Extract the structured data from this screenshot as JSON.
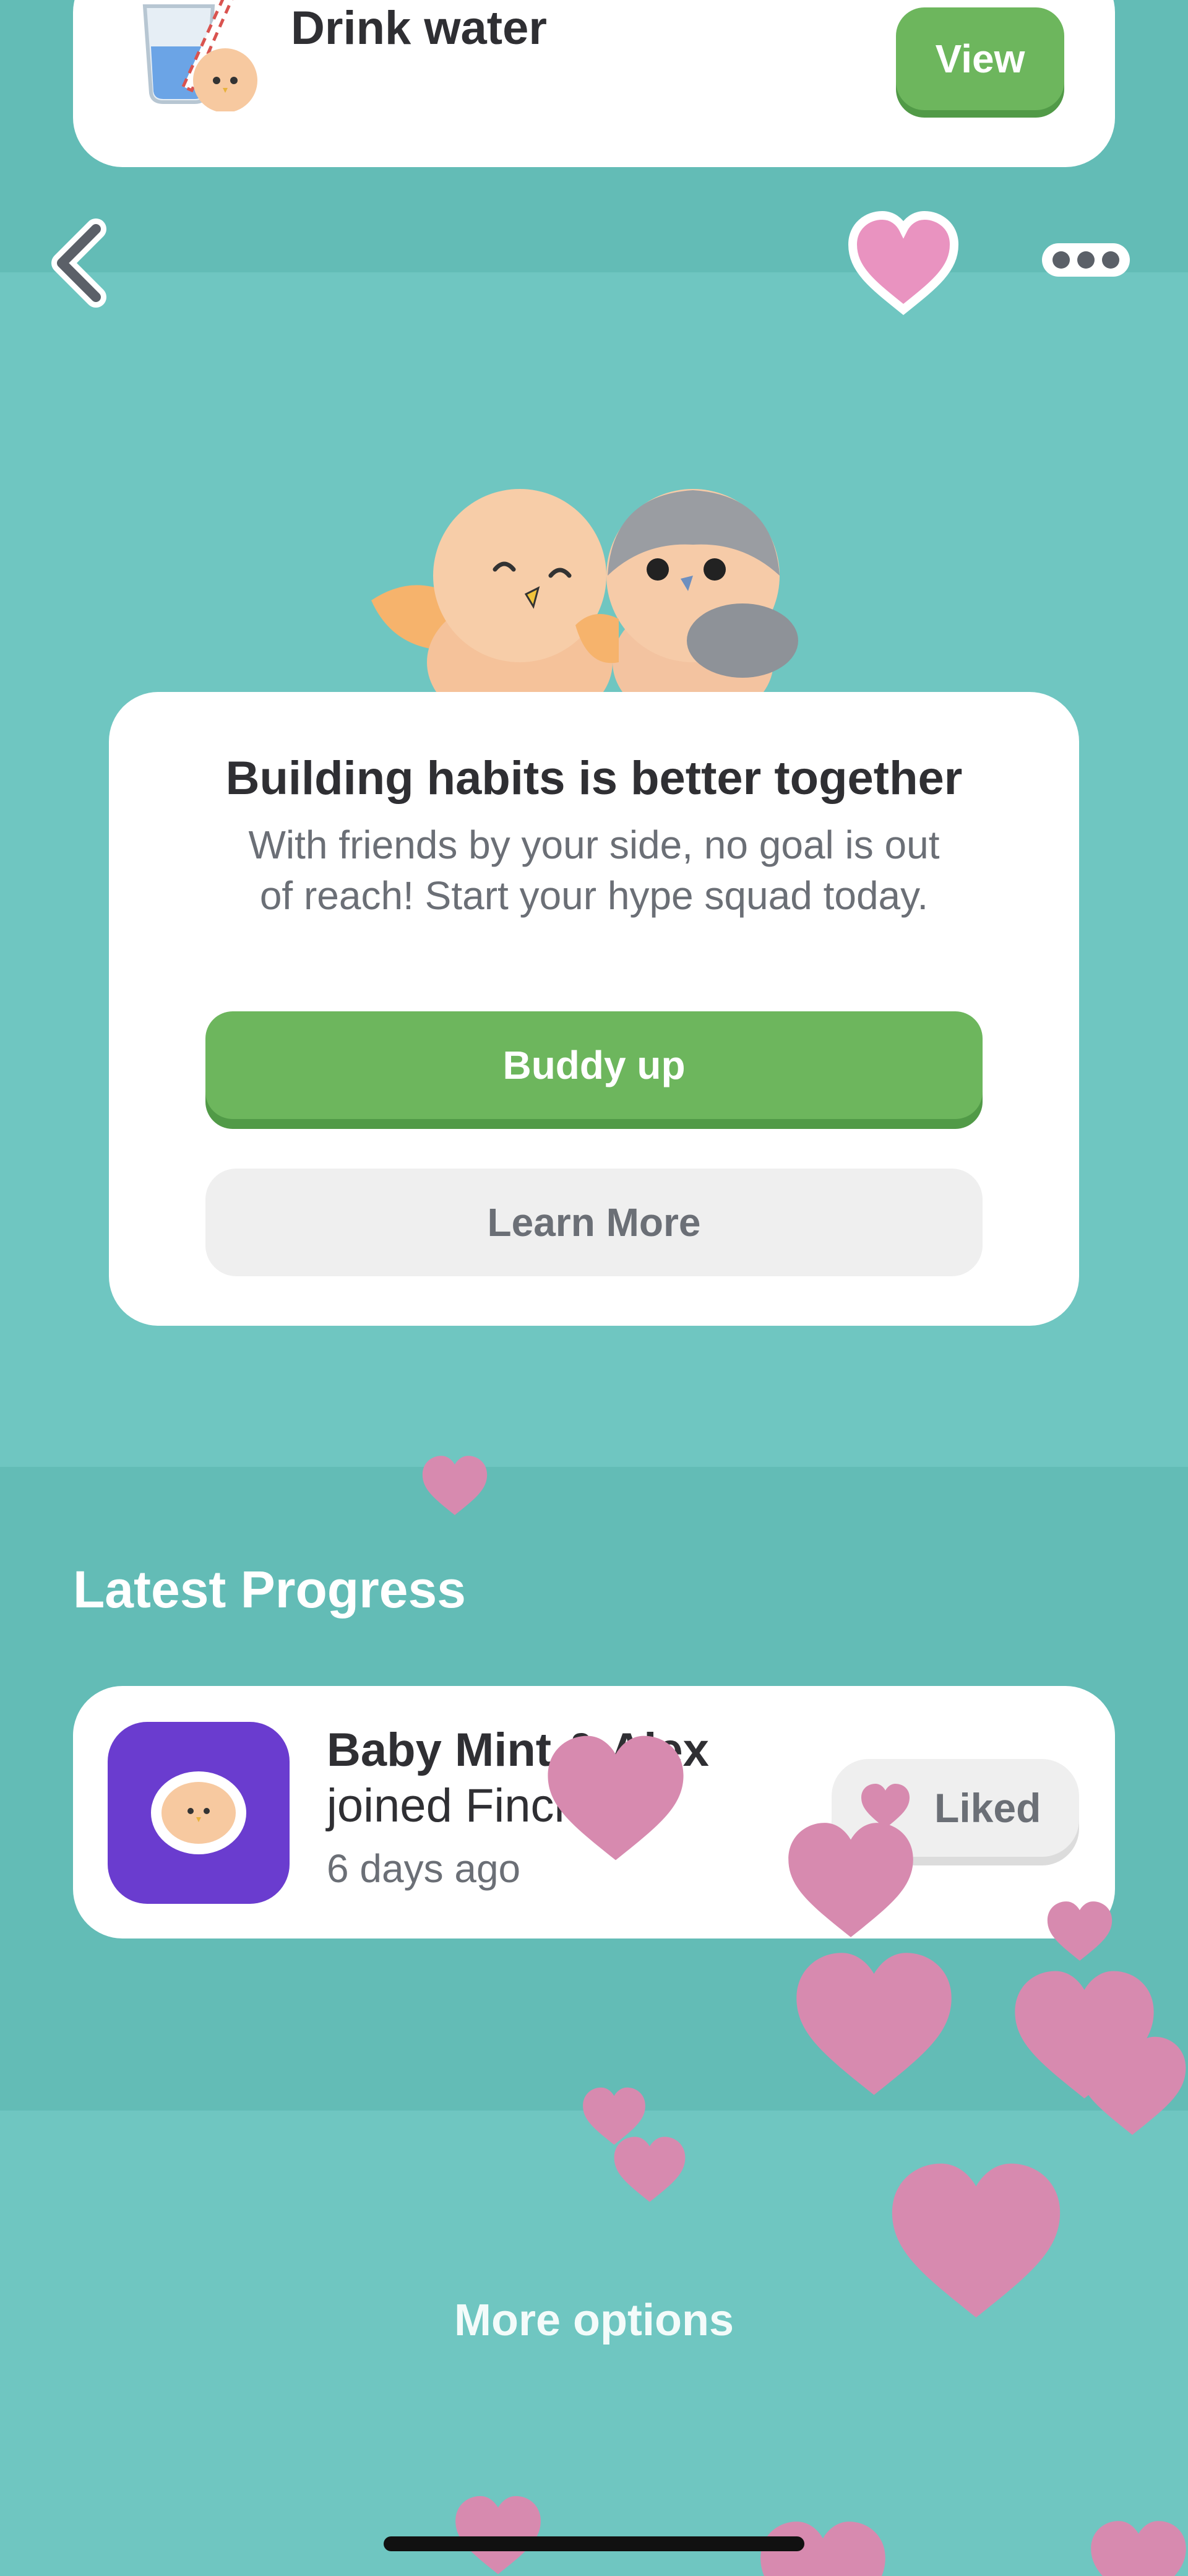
{
  "habit_card": {
    "title": "Drink water",
    "view_label": "View"
  },
  "top_bar": {
    "back_icon": "chevron-left-icon",
    "favorite_icon": "heart-icon",
    "more_icon": "more-dots-icon"
  },
  "buddy_card": {
    "title": "Building habits is better together",
    "description": "With friends by your side, no goal is out of reach! Start your hype squad today.",
    "primary_label": "Buddy up",
    "secondary_label": "Learn More"
  },
  "latest_progress": {
    "heading": "Latest Progress",
    "items": [
      {
        "name": "Baby Mint & Alex",
        "action": "joined Finch",
        "time": "6 days ago",
        "like_label": "Liked"
      }
    ]
  },
  "footer": {
    "more_options_label": "More options"
  },
  "colors": {
    "background": "#6fc6c1",
    "accent_green": "#6db65d",
    "heart_pink": "#d78aaf",
    "avatar_purple": "#6a3ccf"
  }
}
